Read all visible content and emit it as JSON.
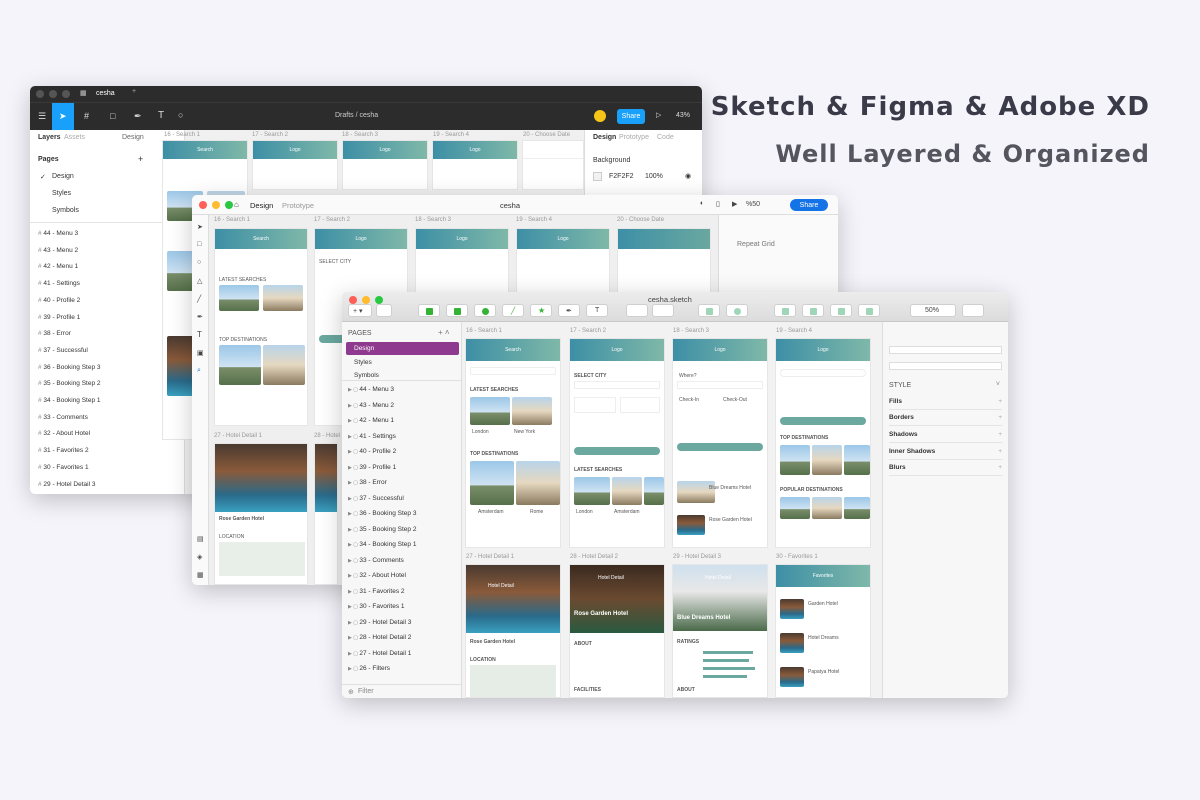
{
  "headline": {
    "line1": "Sketch & Figma & Adobe XD",
    "line2": "Well Layered & Organized"
  },
  "figma": {
    "tab": "cesha",
    "crumb": "Drafts  /  cesha",
    "share": "Share",
    "zoom": "43%",
    "left_tabs": [
      "Layers",
      "Assets",
      "Design"
    ],
    "pages_title": "Pages",
    "pages": [
      "Design",
      "Styles",
      "Symbols"
    ],
    "layers": [
      "44 - Menu 3",
      "43 - Menu 2",
      "42 - Menu 1",
      "41 - Settings",
      "40 - Profile 2",
      "39 - Profile 1",
      "38 - Error",
      "37 - Successful",
      "36 - Booking Step 3",
      "35 - Booking Step 2",
      "34 - Booking Step 1",
      "33 - Comments",
      "32 - About Hotel",
      "31 - Favorites 2",
      "30 - Favorites 1",
      "29 - Hotel Detail 3"
    ],
    "right_tabs": [
      "Design",
      "Prototype",
      "Code"
    ],
    "bg_label": "Background",
    "bg_hex": "F2F2F2",
    "bg_opacity": "100%",
    "artboards": [
      "16 - Search 1",
      "17 - Search 2",
      "18 - Search 3",
      "19 - Search 4",
      "20 - Choose Date"
    ]
  },
  "xd": {
    "tabs": [
      "Design",
      "Prototype"
    ],
    "title": "cesha",
    "zoom": "%50",
    "share": "Share",
    "repeat_grid": "Repeat Grid",
    "artboards": [
      "16 - Search 1",
      "17 - Search 2",
      "18 - Search 3",
      "19 - Search 4",
      "20 - Choose Date"
    ],
    "row2": [
      "27 - Hotel Detail 1",
      "28 - Hotel Detail 2"
    ]
  },
  "sketch": {
    "title": "cesha.sketch",
    "zoom": "50%",
    "pages_title": "PAGES",
    "pages": [
      "Design",
      "Styles",
      "Symbols"
    ],
    "layers": [
      "44 - Menu 3",
      "43 - Menu 2",
      "42 - Menu 1",
      "41 - Settings",
      "40 - Profile 2",
      "39 - Profile 1",
      "38 - Error",
      "37 - Successful",
      "36 - Booking Step 3",
      "35 - Booking Step 2",
      "34 - Booking Step 1",
      "33 - Comments",
      "32 - About Hotel",
      "31 - Favorites 2",
      "30 - Favorites 1",
      "29 - Hotel Detail 3",
      "28 - Hotel Detail 2",
      "27 - Hotel Detail 1",
      "26 - Filters"
    ],
    "filter": "Filter",
    "style_title": "STYLE",
    "props": [
      "Fills",
      "Borders",
      "Shadows",
      "Inner Shadows",
      "Blurs"
    ],
    "artboards": [
      "16 - Search 1",
      "17 - Search 2",
      "18 - Search 3",
      "19 - Search 4"
    ],
    "row2": [
      "27 - Hotel Detail 1",
      "28 - Hotel Detail 2",
      "29 - Hotel Detail 3",
      "30 - Favorites 1"
    ],
    "screen": {
      "search": "Search",
      "logo": "Logo",
      "latest": "LATEST SEARCHES",
      "top": "TOP DESTINATIONS",
      "london": "London",
      "newyork": "New York",
      "amsterdam": "Amsterdam",
      "rome": "Rome",
      "hotel_detail": "Hotel Detail",
      "favorites": "Favorites",
      "rose": "Rose Garden Hotel",
      "blue": "Blue Dreams Hotel",
      "about": "ABOUT",
      "location": "LOCATION",
      "ratings": "RATINGS",
      "facilities": "FACILITIES",
      "select_city": "SELECT CITY",
      "where": "Where?",
      "checkin": "Check-In",
      "checkout": "Check-Out",
      "popular": "POPULAR DESTINATIONS",
      "garden": "Garden Hotel",
      "dreams": "Hotel Dreams",
      "papatya": "Papatya Hotel"
    }
  }
}
